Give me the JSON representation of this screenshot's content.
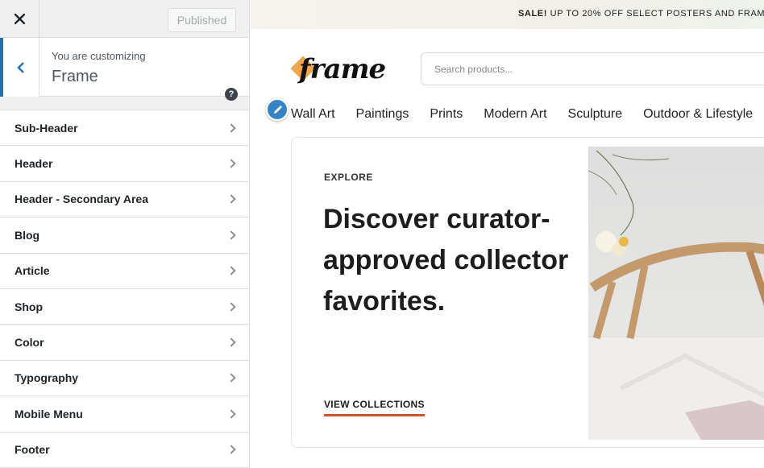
{
  "customizer": {
    "published_label": "Published",
    "info": {
      "subtitle": "You are customizing",
      "title": "Frame"
    },
    "help_glyph": "?",
    "panels": [
      {
        "label": "Sub-Header"
      },
      {
        "label": "Header"
      },
      {
        "label": "Header - Secondary Area"
      },
      {
        "label": "Blog"
      },
      {
        "label": "Article"
      },
      {
        "label": "Shop"
      },
      {
        "label": "Color"
      },
      {
        "label": "Typography"
      },
      {
        "label": "Mobile Menu"
      },
      {
        "label": "Footer"
      }
    ]
  },
  "preview": {
    "promo": {
      "bold": "SALE!",
      "text": " UP TO 20% OFF SELECT POSTERS AND FRAM"
    },
    "logo_text": "frame",
    "search_placeholder": "Search products...",
    "nav": [
      {
        "label": "Wall Art"
      },
      {
        "label": "Paintings"
      },
      {
        "label": "Prints"
      },
      {
        "label": "Modern Art"
      },
      {
        "label": "Sculpture"
      },
      {
        "label": "Outdoor & Lifestyle"
      }
    ],
    "hero": {
      "eyebrow": "EXPLORE",
      "headline": "Discover curator-approved collector favorites.",
      "cta": "VIEW COLLECTIONS"
    }
  },
  "colors": {
    "accent": "#2271b1",
    "cta_underline": "#c9572a",
    "logo_diamond": "#f0a64a",
    "edit_badge": "#3582c4"
  }
}
